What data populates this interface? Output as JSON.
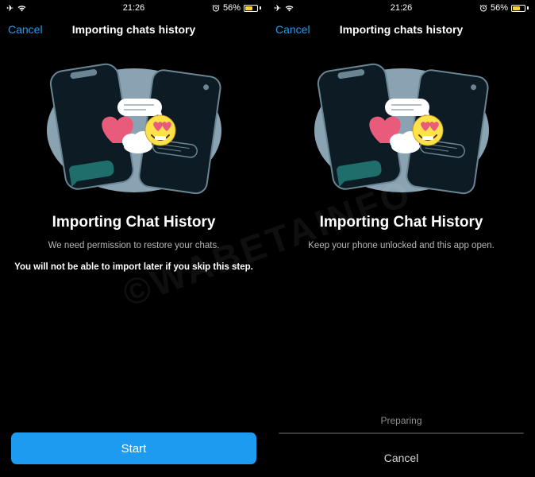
{
  "status": {
    "time": "21:26",
    "battery_pct": "56%"
  },
  "nav": {
    "cancel": "Cancel",
    "title": "Importing chats history"
  },
  "left": {
    "title": "Importing Chat History",
    "subtitle": "We need permission to restore your chats.",
    "warning": "You will not be able to import later if you skip this step.",
    "start": "Start"
  },
  "right": {
    "title": "Importing Chat History",
    "subtitle": "Keep your phone unlocked and this app open.",
    "progress_label": "Preparing",
    "cancel": "Cancel"
  },
  "watermark": "©WABETAINFO"
}
